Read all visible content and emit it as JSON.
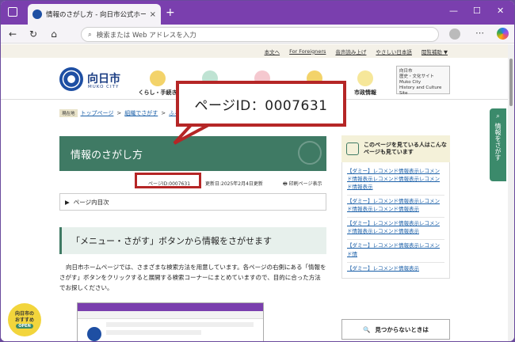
{
  "browser": {
    "tab_title": "情報のさがし方 - 向日市公式ホーム",
    "tab_close": "×",
    "new_tab": "+",
    "address_placeholder": "検索または Web アドレスを入力",
    "win_min": "—",
    "win_max": "☐",
    "win_close": "✕"
  },
  "util_bar": [
    "本文へ",
    "For Foreigners",
    "音声読み上げ",
    "やさしい日本語",
    "閲覧補助 ▼"
  ],
  "site": {
    "name": "向日市",
    "name_en": "MUKO CITY",
    "nav": [
      {
        "label": "くらし・手続き",
        "color": "#f3d36a"
      },
      {
        "label": "",
        "color": "#bfe3d3"
      },
      {
        "label": "",
        "color": "#f5c8cf"
      },
      {
        "label": "",
        "color": "#f3d36a"
      },
      {
        "label": "市政情報",
        "color": "#f6e79a"
      }
    ],
    "history_box": [
      "向日市",
      "歴史・文化サイト",
      "Muko City",
      "History and Culture Site"
    ],
    "side_search": "情報をさがす"
  },
  "breadcrumb": {
    "pos_label": "現在地",
    "items": [
      "トップページ",
      "組織でさがす",
      "ふる"
    ]
  },
  "article": {
    "title": "情報のさがし方",
    "page_id": "ページID:0007631",
    "updated": "更新日:2025年2月4日更新",
    "print": "印刷ページ表示",
    "toc": "ページ内目次",
    "section_heading": "「メニュー・さがす」ボタンから情報をさがせます",
    "body": "向日市ホームページでは、さまざまな検索方法を用意しています。各ページの右側にある「情報をさがす」ボタンをクリックすると展開する検索コーナーにまとめていますので、目的に合った方法でお探しください。"
  },
  "callout": "ページID：0007631",
  "sidebar": {
    "recommend_title": "このページを見ている人はこんなページも見ています",
    "links": [
      "【ダミー】レコメンド情報表示レコメンド情報表示レコメンド情報表示レコメンド情報表示",
      "【ダミー】レコメンド情報表示レコメンド情報表示レコメンド情報表示",
      "【ダミー】レコメンド情報表示レコメンド情報表示レコメンド情報表示",
      "【ダミー】レコメンド情報表示レコメンド情",
      "【ダミー】レコメンド情報表示"
    ],
    "not_found": "見つからないときは"
  },
  "osusume": [
    "向日市の",
    "おすすめ",
    "OPEN"
  ],
  "colors": {
    "titlebar": "#7a3fae",
    "accent_green": "#3f7a64",
    "callout_red": "#b52626"
  }
}
